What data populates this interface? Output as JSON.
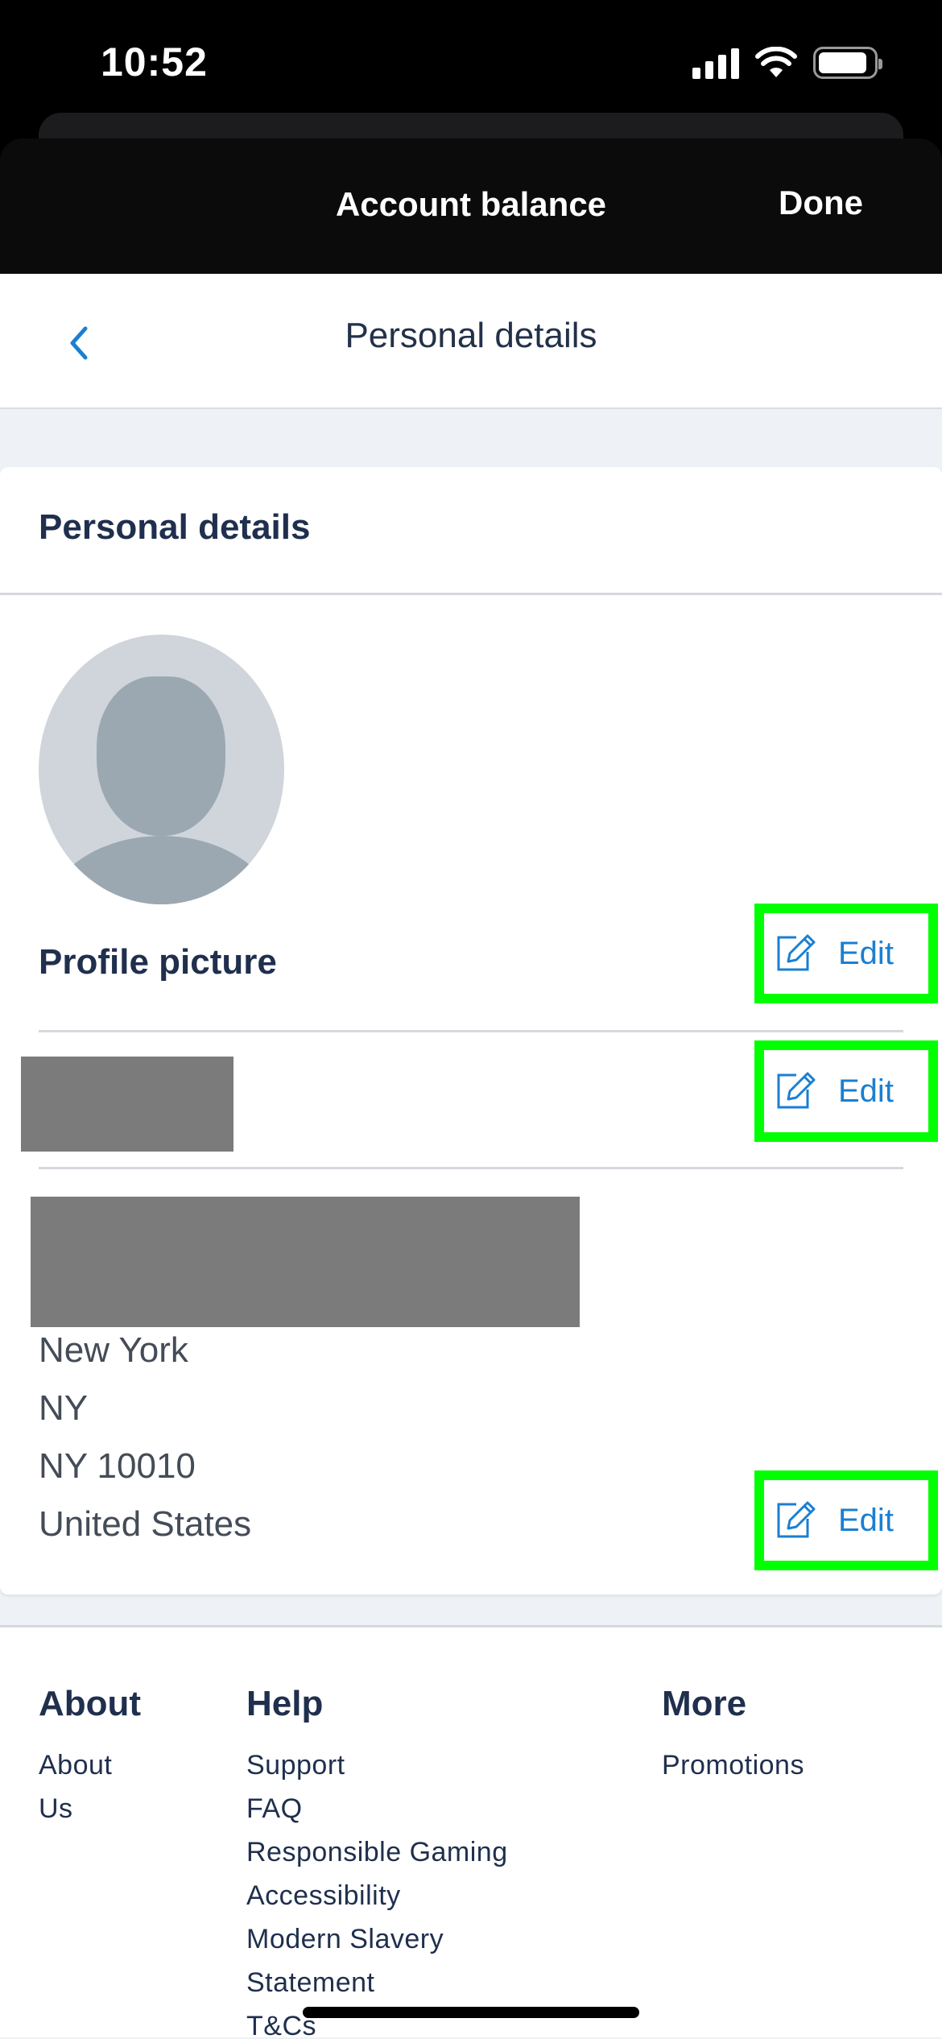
{
  "status_bar": {
    "time": "10:52",
    "icons": [
      "signal-icon",
      "wifi-icon",
      "battery-icon"
    ]
  },
  "modal": {
    "title": "Account balance",
    "done_label": "Done"
  },
  "nav": {
    "title": "Personal details",
    "back_icon": "chevron-left-icon"
  },
  "card": {
    "title": "Personal details",
    "profile_picture_label": "Profile picture",
    "edit_label": "Edit",
    "address_lines": [
      "New York",
      "NY",
      "NY 10010",
      "United States"
    ]
  },
  "footer": {
    "about": {
      "heading": "About",
      "links": [
        "About",
        "Us"
      ]
    },
    "help": {
      "heading": "Help",
      "links": [
        "Support",
        "FAQ",
        "Responsible Gaming",
        "Accessibility",
        "Modern Slavery",
        "Statement",
        "T&Cs"
      ]
    },
    "more": {
      "heading": "More",
      "links": [
        "Promotions"
      ]
    }
  },
  "colors": {
    "accent": "#1a7fd2",
    "highlight": "#00ff00",
    "heading": "#1f2f4d",
    "redacted": "#7b7b7b"
  }
}
